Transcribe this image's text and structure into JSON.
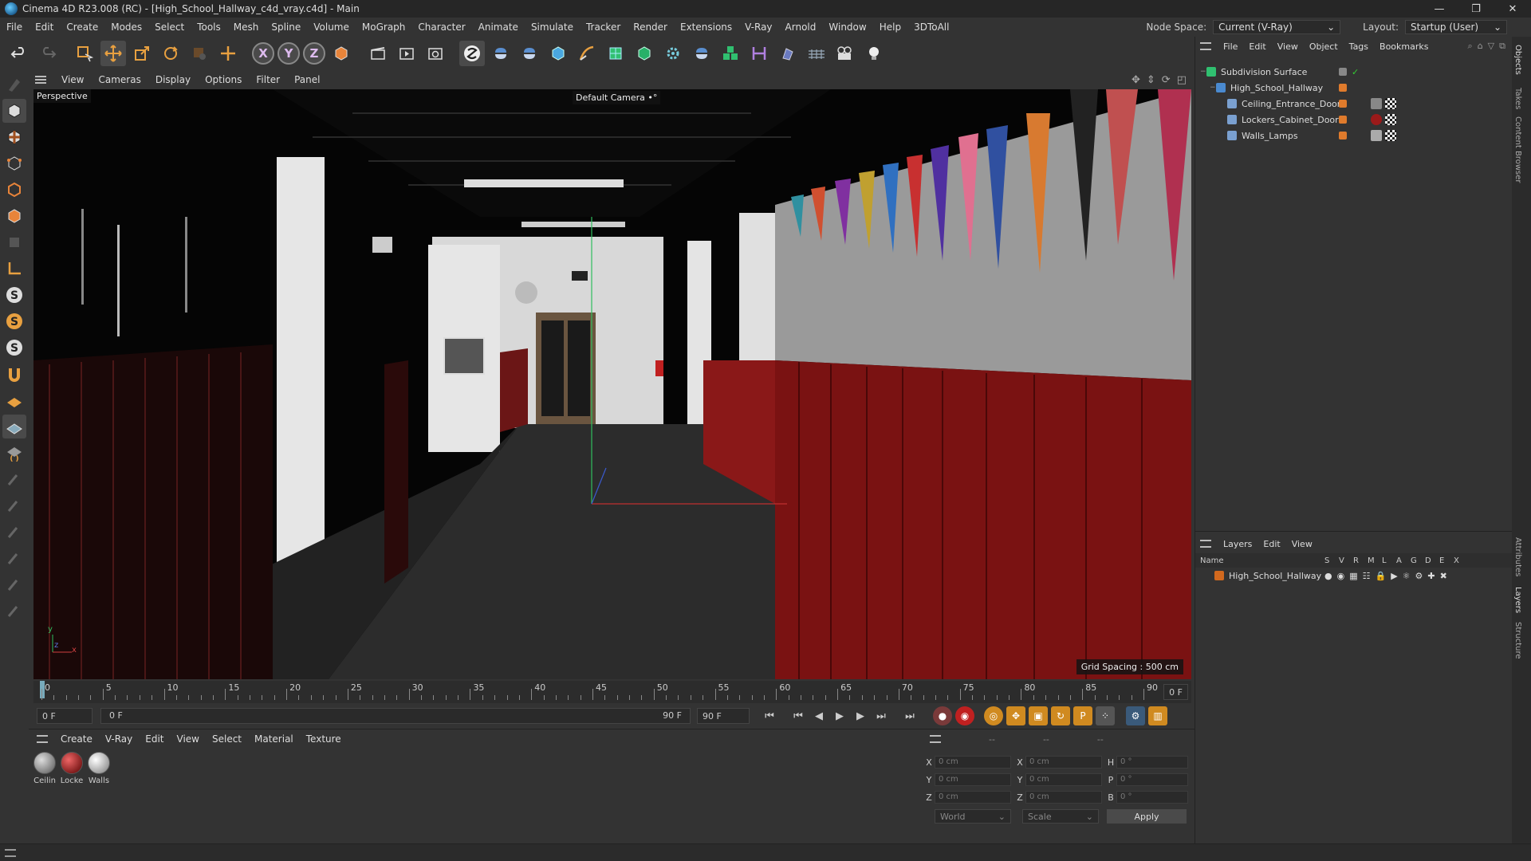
{
  "window": {
    "title": "Cinema 4D R23.008 (RC) - [High_School_Hallway_c4d_vray.c4d] - Main",
    "minimize": "—",
    "maximize": "❐",
    "close": "✕"
  },
  "menubar": {
    "items": [
      "File",
      "Edit",
      "Create",
      "Modes",
      "Select",
      "Tools",
      "Mesh",
      "Spline",
      "Volume",
      "MoGraph",
      "Character",
      "Animate",
      "Simulate",
      "Tracker",
      "Render",
      "Extensions",
      "V-Ray",
      "Arnold",
      "Window",
      "Help",
      "3DToAll"
    ],
    "node_space_label": "Node Space:",
    "node_space_value": "Current (V-Ray)",
    "layout_label": "Layout:",
    "layout_value": "Startup (User)"
  },
  "toolbar": {
    "axis_x": "X",
    "axis_y": "Y",
    "axis_z": "Z"
  },
  "viewport": {
    "menu": [
      "View",
      "Cameras",
      "Display",
      "Options",
      "Filter",
      "Panel"
    ],
    "view_name": "Perspective",
    "camera_label": "Default Camera",
    "camera_icon": "•°",
    "grid_spacing": "Grid Spacing : 500 cm",
    "axis_y": "y",
    "axis_x": "x",
    "axis_z": "z"
  },
  "timeline": {
    "ticks": [
      0,
      5,
      10,
      15,
      20,
      25,
      30,
      35,
      40,
      45,
      50,
      55,
      60,
      65,
      70,
      75,
      80,
      85,
      90
    ],
    "current_frame_right": "0 F",
    "start_field": "0 F",
    "range_start": "0 F",
    "range_end": "90 F",
    "end_field": "90 F"
  },
  "material_panel": {
    "menu": [
      "Create",
      "V-Ray",
      "Edit",
      "View",
      "Select",
      "Material",
      "Texture"
    ],
    "materials": [
      {
        "name": "Ceilin",
        "color": "#8a8a8a"
      },
      {
        "name": "Locke",
        "color": "#9b1a1a"
      },
      {
        "name": "Walls",
        "color": "#b5b5b5"
      }
    ]
  },
  "coordinates": {
    "header_a": "--",
    "header_b": "--",
    "header_c": "--",
    "rows": [
      {
        "l1": "X",
        "v1": "0 cm",
        "l2": "X",
        "v2": "0 cm",
        "l3": "H",
        "v3": "0 °"
      },
      {
        "l1": "Y",
        "v1": "0 cm",
        "l2": "Y",
        "v2": "0 cm",
        "l3": "P",
        "v3": "0 °"
      },
      {
        "l1": "Z",
        "v1": "0 cm",
        "l2": "Z",
        "v2": "0 cm",
        "l3": "B",
        "v3": "0 °"
      }
    ],
    "mode_world": "World",
    "mode_scale": "Scale",
    "apply": "Apply"
  },
  "object_manager": {
    "menu": [
      "File",
      "Edit",
      "View",
      "Object",
      "Tags",
      "Bookmarks"
    ],
    "objects": [
      {
        "name": "Subdivision Surface",
        "indent": 0
      },
      {
        "name": "High_School_Hallway",
        "indent": 1
      },
      {
        "name": "Ceiling_Entrance_Doors",
        "indent": 2
      },
      {
        "name": "Lockers_Cabinet_Doors",
        "indent": 2
      },
      {
        "name": "Walls_Lamps",
        "indent": 2
      }
    ]
  },
  "layer_manager": {
    "menu": [
      "Layers",
      "Edit",
      "View"
    ],
    "col_name": "Name",
    "cols": [
      "S",
      "V",
      "R",
      "M",
      "L",
      "A",
      "G",
      "D",
      "E",
      "X"
    ],
    "layers": [
      {
        "name": "High_School_Hallway",
        "color": "#d2691e"
      }
    ]
  },
  "side_tabs": [
    "Objects",
    "Takes",
    "Content Browser",
    "Attributes",
    "Layers",
    "Structure"
  ],
  "colors": {
    "accent_orange": "#e07b2c",
    "locker_red": "#8b1414",
    "selection_blue": "#4a7aa8"
  }
}
